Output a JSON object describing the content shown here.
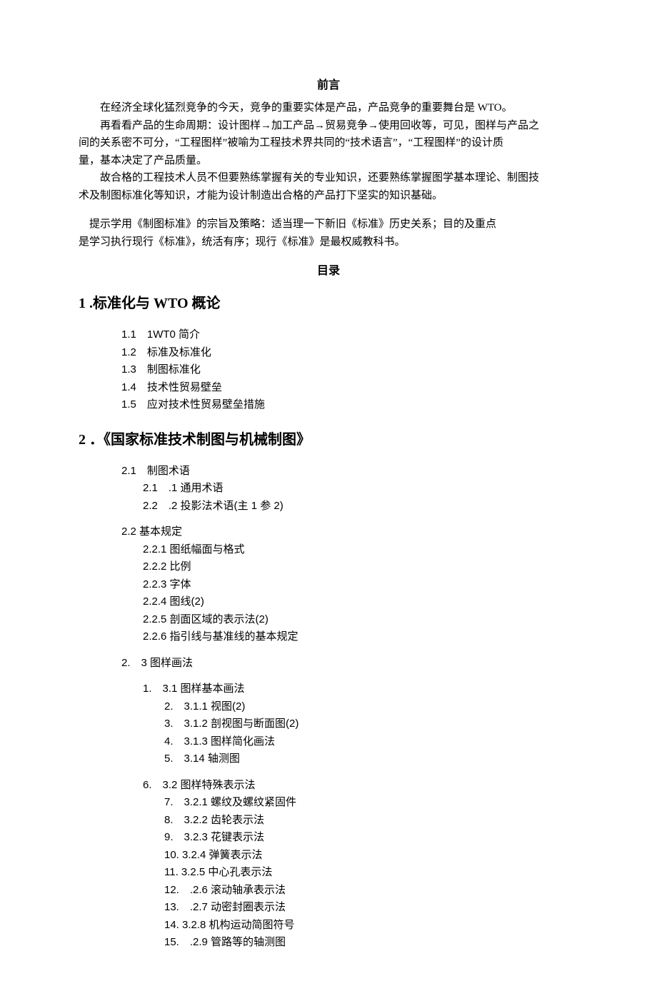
{
  "preface": {
    "title": "前言",
    "p1": "在经济全球化猛烈竞争的今天，竞争的重要实体是产品，产品竞争的重要舞台是 WTO。",
    "p2a": "再看看产品的生命周期：设计图样→加工产品→贸易竞争→使用回收等，可见，图样与产品之",
    "p2b": "间的关系密不可分，“工程图样”被喻为工程技术界共同的“技术语言”，“工程图样”的设计质",
    "p2c": "量，基本决定了产品质量。",
    "p3a": "故合格的工程技术人员不但要熟练掌握有关的专业知识，还要熟练掌握图学基本理论、制图技",
    "p3b": "术及制图标准化等知识，才能为设计制造出合格的产品打下坚实的知识基础。",
    "tip1": "　提示学用《制图标准》的宗旨及策略：适当理一下新旧《标准》历史关系；目的及重点",
    "tip2": "是学习执行现行《标准》，统活有序；现行《标准》是最权威教科书。"
  },
  "toc": {
    "title": "目录",
    "s1": {
      "num": "1 .",
      "title": "标准化与",
      "wto": " WTO ",
      "suffix": "概论",
      "items": [
        "1.1　1WT0 简介",
        "1.2　标准及标准化",
        "1.3　制图标准化",
        "1.4　技术性贸易壁垒",
        "1.5　应对技术性贸易壁垒措施"
      ]
    },
    "s2": {
      "num": "2 ．",
      "title": "《国家标准技术制图与机械制图》",
      "g21": {
        "head": "2.1　制图术语",
        "a": "2.1　.1 通用术语",
        "b": "2.2　.2 投影法术语(主 1 参 2)"
      },
      "g22": {
        "head": "2.2 基本规定",
        "items": [
          "2.2.1 图纸幅面与格式",
          "2.2.2 比例",
          "2.2.3 字体",
          "2.2.4 图线(2)",
          "2.2.5 剖面区域的表示法(2)",
          "2.2.6 指引线与基准线的基本规定"
        ]
      },
      "g23": {
        "head": "2.　3 图样画法",
        "g231": {
          "head": "1.　3.1 图样基本画法",
          "items": [
            "2.　3.1.1 视图(2)",
            "3.　3.1.2 剖视图与断面图(2)",
            "4.　3.1.3 图样简化画法",
            "5.　3.14 轴测图"
          ]
        },
        "g232": {
          "head": "6.　3.2 图样特殊表示法",
          "items": [
            "7.　3.2.1 螺纹及螺纹紧固件",
            "8.　3.2.2 齿轮表示法",
            "9.　3.2.3 花键表示法",
            "10. 3.2.4 弹簧表示法",
            "11. 3.2.5 中心孔表示法",
            "12.　.2.6 滚动轴承表示法",
            "13.　.2.7 动密封圈表示法",
            "14. 3.2.8 机构运动简图符号",
            "15.　.2.9 管路等的轴测图"
          ]
        }
      }
    }
  }
}
